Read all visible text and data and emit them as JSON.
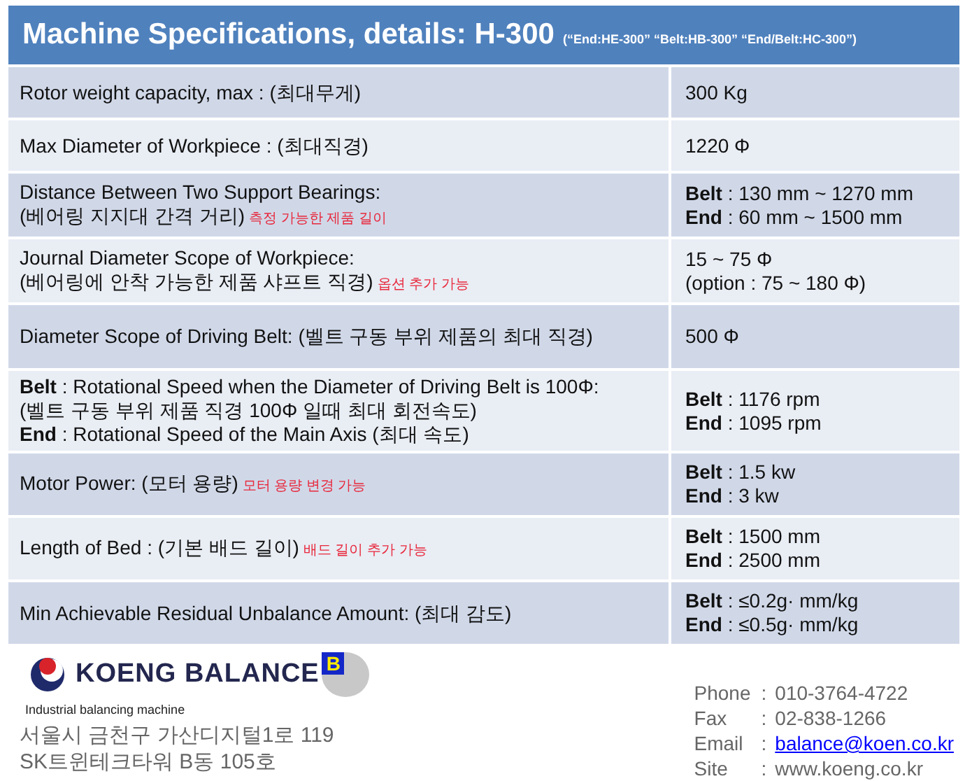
{
  "title": {
    "main": "Machine Specifications, details: H-300",
    "models": "(“End:HE-300”  “Belt:HB-300” “End/Belt:HC-300”)"
  },
  "rows": [
    {
      "label": [
        "Rotor weight capacity, max : (최대무게)"
      ],
      "value": [
        "300 Kg"
      ]
    },
    {
      "label": [
        "Max Diameter of Workpiece  : (최대직경)"
      ],
      "value": [
        "1220 Φ"
      ]
    },
    {
      "label": [
        "Distance Between Two Support Bearings:",
        "(베어링 지지대 간격 거리)"
      ],
      "note": "측정 가능한 제품 길이",
      "value": [
        "**Belt** : 130 mm ~ 1270 mm",
        "**End** : 60 mm ~ 1500 mm"
      ]
    },
    {
      "label": [
        "Journal Diameter Scope of Workpiece:",
        "(베어링에 안착 가능한 제품 샤프트 직경)"
      ],
      "note": "옵션 추가 가능",
      "value": [
        "15 ~ 75 Φ",
        "(option : 75 ~ 180 Φ)"
      ]
    },
    {
      "label": [
        "Diameter Scope of Driving Belt: (벨트 구동 부위 제품의 최대 직경)"
      ],
      "value": [
        "500 Φ"
      ]
    },
    {
      "label": [
        "**Belt** : Rotational Speed when the Diameter of Driving Belt is 100Φ:",
        "(벨트 구동 부위 제품 직경 100Φ 일때 최대 회전속도)",
        "**End** : Rotational Speed of the Main Axis (최대 속도)"
      ],
      "value": [
        "**Belt** : 1176 rpm",
        "**End** : 1095 rpm"
      ]
    },
    {
      "label": [
        "Motor Power: (모터 용량)"
      ],
      "note": "모터 용량 변경 가능",
      "value": [
        "**Belt** : 1.5 kw",
        "**End** : 3 kw"
      ]
    },
    {
      "label": [
        "Length of Bed : (기본 배드 길이)"
      ],
      "note": "배드 길이 추가 가능",
      "value": [
        "**Belt** : 1500 mm",
        "**End** : 2500 mm"
      ]
    },
    {
      "label": [
        "Min Achievable Residual Unbalance Amount: (최대 감도)"
      ],
      "value": [
        "**Belt** : ≤0.2g· mm/kg",
        "**End** : ≤0.5g· mm/kg"
      ]
    }
  ],
  "company": {
    "name": "KOENG BALANCE",
    "badge": "B",
    "tagline": "Industrial balancing machine",
    "address": [
      "서울시 금천구 가산디지털1로 119",
      "SK트윈테크타워 B동 105호"
    ]
  },
  "contacts": [
    {
      "label": "Phone",
      "sep": ":",
      "value": "010-3764-4722",
      "kind": "text"
    },
    {
      "label": "Fax",
      "sep": ":",
      "value": "02-838-1266",
      "kind": "text"
    },
    {
      "label": "Email",
      "sep": ":",
      "value": "balance@koen.co.kr",
      "kind": "link"
    },
    {
      "label": "Site",
      "sep": ":",
      "value": "www.koeng.co.kr",
      "kind": "text"
    }
  ]
}
